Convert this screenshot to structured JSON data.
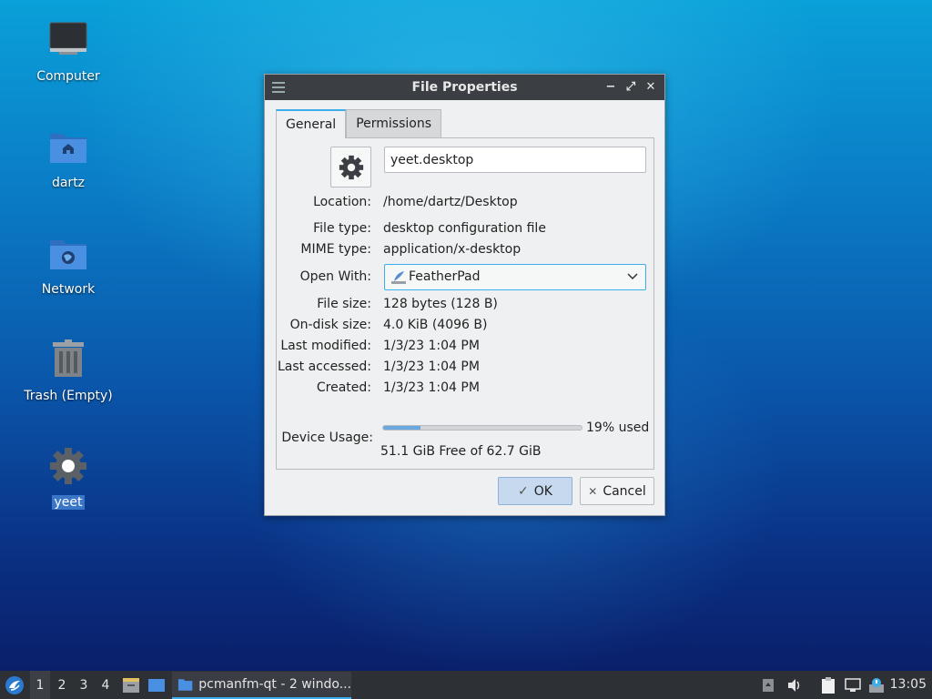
{
  "desktop": {
    "icons": [
      {
        "label": "Computer"
      },
      {
        "label": "dartz"
      },
      {
        "label": "Network"
      },
      {
        "label": "Trash (Empty)"
      },
      {
        "label": "yeet",
        "selected": true
      }
    ]
  },
  "window": {
    "title": "File Properties",
    "controls": {
      "minimize": "−",
      "maximize": "⤢",
      "close": "✕"
    },
    "tabs": [
      {
        "label": "General",
        "active": true
      },
      {
        "label": "Permissions",
        "active": false
      }
    ],
    "file_name": "yeet.desktop",
    "fields": {
      "location": {
        "label": "Location:",
        "value": "/home/dartz/Desktop"
      },
      "file_type": {
        "label": "File type:",
        "value": "desktop configuration file"
      },
      "mime_type": {
        "label": "MIME type:",
        "value": "application/x-desktop"
      },
      "open_with": {
        "label": "Open With:",
        "value": "FeatherPad"
      },
      "file_size": {
        "label": "File size:",
        "value": "128 bytes (128 B)"
      },
      "on_disk_size": {
        "label": "On-disk size:",
        "value": "4.0 KiB (4096 B)"
      },
      "last_modified": {
        "label": "Last modified:",
        "value": "1/3/23 1:04 PM"
      },
      "last_accessed": {
        "label": "Last accessed:",
        "value": "1/3/23 1:04 PM"
      },
      "created": {
        "label": "Created:",
        "value": "1/3/23 1:04 PM"
      }
    },
    "device_usage": {
      "label": "Device Usage:",
      "percent_used": 19,
      "used_text": "19% used",
      "free_text": "51.1 GiB Free of 62.7 GiB"
    },
    "buttons": {
      "ok": {
        "label": "OK",
        "icon": "✓"
      },
      "cancel": {
        "label": "Cancel",
        "icon": "✕"
      }
    }
  },
  "taskbar": {
    "desktops": [
      "1",
      "2",
      "3",
      "4"
    ],
    "active_desktop": "1",
    "task": "pcmanfm-qt - 2 windo...",
    "clock": "13:05"
  },
  "colors": {
    "accent": "#3daee9",
    "titlebar": "#3b3e43",
    "taskbar": "#2d3035",
    "progress_fill": "#6aa9e0"
  }
}
